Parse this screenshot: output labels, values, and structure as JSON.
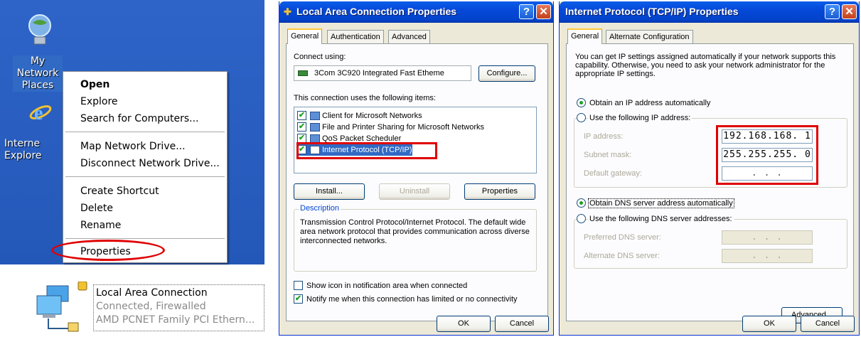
{
  "desktop": {
    "icons": [
      {
        "label_line1": "My Network",
        "label_line2": "Places"
      },
      {
        "label_line1": "Interne",
        "label_line2": "Explore"
      }
    ],
    "context_menu": {
      "items": [
        {
          "label": "Open"
        },
        {
          "label": "Explore"
        },
        {
          "label": "Search for Computers..."
        },
        {
          "label": "Map Network Drive..."
        },
        {
          "label": "Disconnect Network Drive..."
        },
        {
          "label": "Create Shortcut"
        },
        {
          "label": "Delete"
        },
        {
          "label": "Rename"
        },
        {
          "label": "Properties"
        }
      ]
    }
  },
  "connection_icon": {
    "name": "Local Area Connection",
    "status": "Connected, Firewalled",
    "device": "AMD PCNET Family PCI Ethern..."
  },
  "lac_dialog": {
    "title": "Local Area Connection Properties",
    "tabs": [
      "General",
      "Authentication",
      "Advanced"
    ],
    "connect_using_label": "Connect using:",
    "adapter": "3Com 3C920 Integrated Fast Etheme",
    "configure_button": "Configure...",
    "items_label": "This connection uses the following items:",
    "items": [
      {
        "label": "Client for Microsoft Networks",
        "checked": true
      },
      {
        "label": "File and Printer Sharing for Microsoft Networks",
        "checked": true
      },
      {
        "label": "QoS Packet Scheduler",
        "checked": true
      },
      {
        "label": "Internet Protocol (TCP/IP)",
        "checked": true
      }
    ],
    "install_button": "Install...",
    "uninstall_button": "Uninstall",
    "properties_button": "Properties",
    "description_label": "Description",
    "description_text": "Transmission Control Protocol/Internet Protocol. The default wide area network protocol that provides communication across diverse interconnected networks.",
    "show_icon_label": "Show icon in notification area when connected",
    "notify_label": "Notify me when this connection has limited or no connectivity",
    "ok_button": "OK",
    "cancel_button": "Cancel"
  },
  "tcpip_dialog": {
    "title": "Internet Protocol (TCP/IP) Properties",
    "tabs": [
      "General",
      "Alternate Configuration"
    ],
    "intro_text": "You can get IP settings assigned automatically if your network supports this capability. Otherwise, you need to ask your network administrator for the appropriate IP settings.",
    "obtain_ip_label": "Obtain an IP address automatically",
    "use_ip_label": "Use the following IP address:",
    "ip_address_label": "IP address:",
    "ip_address_value": "192.168.168. 1",
    "subnet_label": "Subnet mask:",
    "subnet_value": "255.255.255. 0",
    "gateway_label": "Default gateway:",
    "gateway_value": ". . .",
    "obtain_dns_label": "Obtain DNS server address automatically",
    "use_dns_label": "Use the following DNS server addresses:",
    "preferred_dns_label": "Preferred DNS server:",
    "preferred_dns_value": ". . .",
    "alternate_dns_label": "Alternate DNS server:",
    "alternate_dns_value": ". . .",
    "advanced_button": "Advanced...",
    "ok_button": "OK",
    "cancel_button": "Cancel"
  },
  "colors": {
    "desktop_blue": "#2e64c8",
    "titlebar_blue": "#0648d9",
    "dialog_face": "#ece9d8",
    "highlight_red": "#e00000",
    "check_green": "#21a121"
  }
}
